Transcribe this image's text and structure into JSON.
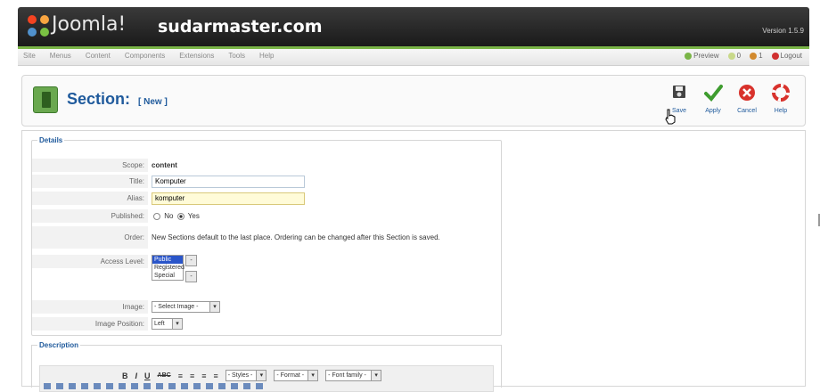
{
  "header": {
    "logo_text": "Joomla!",
    "site_name": "sudarmaster.com",
    "version": "Version 1.5.9"
  },
  "menu": {
    "items": [
      "Site",
      "Menus",
      "Content",
      "Components",
      "Extensions",
      "Tools",
      "Help"
    ],
    "preview": "Preview",
    "messages_count": "0",
    "users_count": "1",
    "logout": "Logout"
  },
  "toolbar": {
    "title": "Section:",
    "subtitle": "[ New ]",
    "save": "Save",
    "apply": "Apply",
    "cancel": "Cancel",
    "help": "Help"
  },
  "details": {
    "legend": "Details",
    "scope_label": "Scope:",
    "scope_value": "content",
    "title_label": "Title:",
    "title_value": "Komputer",
    "alias_label": "Alias:",
    "alias_value": "komputer",
    "published_label": "Published:",
    "published_no": "No",
    "published_yes": "Yes",
    "order_label": "Order:",
    "order_text": "New Sections default to the last place. Ordering can be changed after this Section is saved.",
    "access_label": "Access Level:",
    "access_options": [
      "Public",
      "Registered",
      "Special"
    ],
    "image_label": "Image:",
    "image_value": "- Select Image -",
    "image_position_label": "Image Position:",
    "image_position_value": "Left"
  },
  "description": {
    "legend": "Description",
    "bold": "B",
    "italic": "I",
    "underline": "U",
    "strike": "ABC",
    "styles": "- Styles -",
    "format": "- Format -",
    "font_family": "- Font family -"
  },
  "colors": {
    "header_bg": "#222222",
    "accent_green": "#7ab547",
    "title_blue": "#1f5a9c"
  }
}
